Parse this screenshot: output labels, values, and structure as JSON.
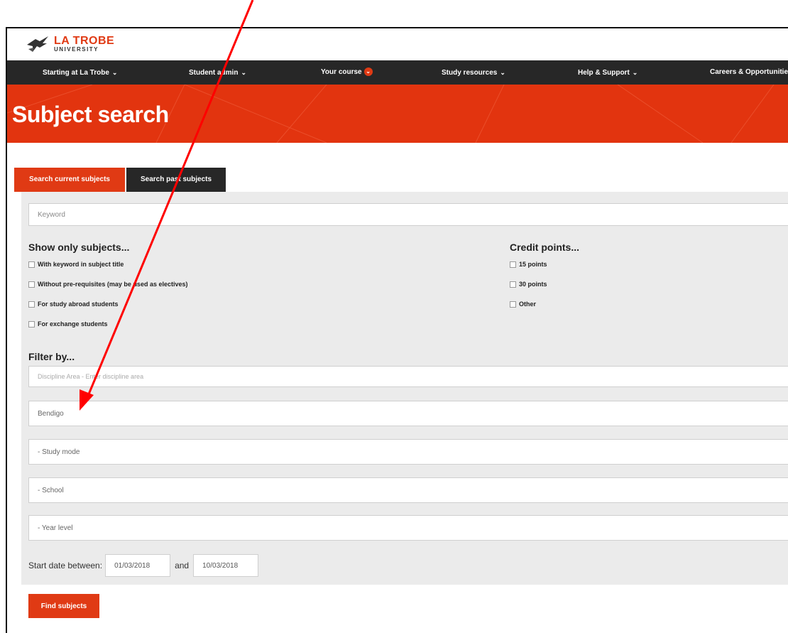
{
  "brand": {
    "name_line1": "LA TROBE",
    "name_line2": "UNIVERSITY",
    "color": "#e03a14"
  },
  "nav": {
    "items": [
      {
        "label": "Starting at La Trobe",
        "icon": "chevron-down-icon"
      },
      {
        "label": "Student admin",
        "icon": "chevron-down-icon"
      },
      {
        "label": "Your course",
        "icon": "chevron-down-badge-icon"
      },
      {
        "label": "Study resources",
        "icon": "chevron-down-icon"
      },
      {
        "label": "Help & Support",
        "icon": "chevron-down-icon"
      },
      {
        "label": "Careers & Opportunities",
        "icon": ""
      }
    ]
  },
  "hero": {
    "title": "Subject search",
    "background": "#e2340f"
  },
  "tabs": [
    {
      "label": "Search current subjects",
      "active": true
    },
    {
      "label": "Search past subjects",
      "active": false
    }
  ],
  "search": {
    "keyword_placeholder": "Keyword"
  },
  "show_only": {
    "heading": "Show only subjects...",
    "options": [
      "With keyword in subject title",
      "Without pre-requisites (may be used as electives)",
      "For study abroad students",
      "For exchange students"
    ]
  },
  "credit_points": {
    "heading": "Credit points...",
    "options": [
      "15 points",
      "30 points",
      "Other"
    ]
  },
  "filter": {
    "heading": "Filter by...",
    "discipline_placeholder": "Discipline Area - Enter discipline area",
    "campus_value": "Bendigo",
    "study_mode": "- Study mode",
    "school": "- School",
    "year_level": "- Year level"
  },
  "dates": {
    "label": "Start date between:",
    "from": "01/03/2018",
    "and_label": "and",
    "to": "10/03/2018"
  },
  "actions": {
    "find_label": "Find subjects"
  },
  "annotation": {
    "arrow_color": "#ff0000"
  }
}
